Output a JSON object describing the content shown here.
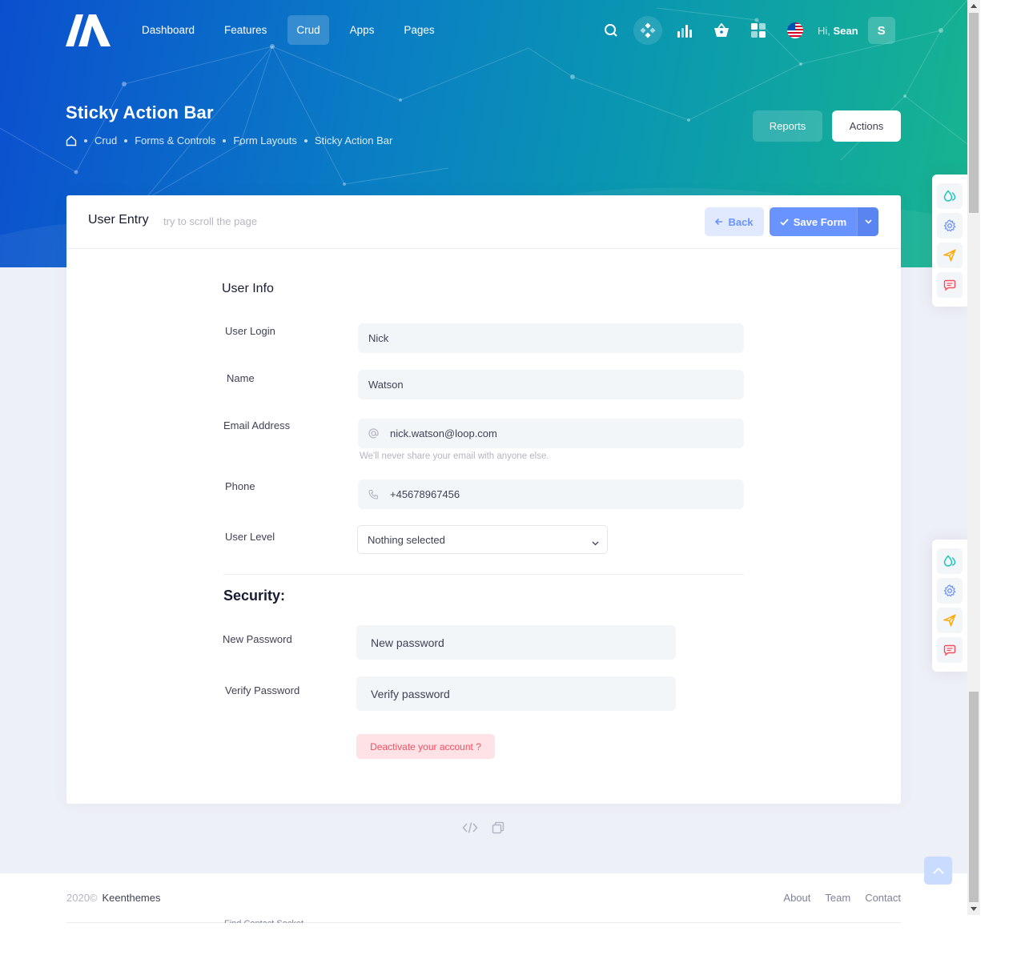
{
  "header": {
    "nav": [
      "Dashboard",
      "Features",
      "Crud",
      "Apps",
      "Pages"
    ],
    "active_nav": "Crud",
    "greeting_prefix": "Hi,",
    "user_name": "Sean",
    "avatar_letter": "S"
  },
  "subheader": {
    "title": "Sticky Action Bar",
    "breadcrumb": [
      "Crud",
      "Forms & Controls",
      "Form Layouts",
      "Sticky Action Bar"
    ],
    "reports_label": "Reports",
    "actions_label": "Actions"
  },
  "card": {
    "title": "User Entry",
    "subtitle": "try to scroll the page",
    "back_label": "Back",
    "save_label": "Save Form"
  },
  "user_info": {
    "section_title": "User Info",
    "login_label": "User Login",
    "login_value": "Nick",
    "name_label": "Name",
    "name_value": "Watson",
    "email_label": "Email Address",
    "email_value": "nick.watson@loop.com",
    "email_hint": "We'll never share your email with anyone else.",
    "phone_label": "Phone",
    "phone_value": "+45678967456",
    "level_label": "User Level",
    "level_value": "Nothing selected"
  },
  "security": {
    "section_title": "Security:",
    "new_password_label": "New Password",
    "new_password_placeholder": "New password",
    "verify_password_label": "Verify Password",
    "verify_password_placeholder": "Verify password",
    "deactivate_label": "Deactivate your account ?"
  },
  "footer": {
    "year": "2020©",
    "company": "Keenthemes",
    "links": [
      "About",
      "Team",
      "Contact"
    ],
    "ghost_text": "Find Contact Socket"
  },
  "colors": {
    "primary": "#6993ff",
    "danger": "#f64e60",
    "hero_start": "#0b4fcf",
    "hero_end": "#17b58f"
  },
  "icons": {
    "sticky_toolbar": [
      "drop-icon",
      "gear-icon",
      "send-icon",
      "chat-icon"
    ]
  }
}
